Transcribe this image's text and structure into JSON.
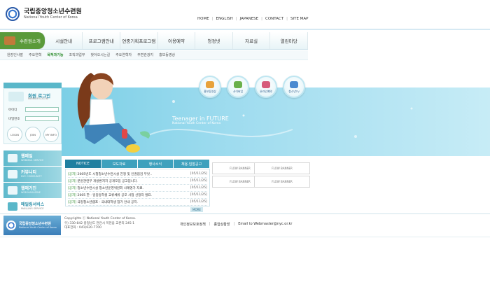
{
  "header": {
    "title": "국립중앙청소년수련원",
    "subtitle": "National Youth Center of Korea",
    "links": [
      "HOME",
      "ENGLISH",
      "JAPANESE",
      "CONTACT",
      "SITE MAP"
    ]
  },
  "nav": {
    "items": [
      "수련원소개",
      "시설안내",
      "프로그램안내",
      "연중기획프로그램",
      "이용예약",
      "청정넷",
      "자료실",
      "열린마당"
    ],
    "sub": [
      "원장인사말",
      "주요연혁",
      "목적과기능",
      "조직과업무",
      "찾아오시는길",
      "주요연혁자",
      "주변관광지",
      "홍보동영상"
    ]
  },
  "banner": {
    "tagline": "Teenager in FUTURE",
    "tagline_sub": "National Youth Center of Korea",
    "circles": [
      "홍보동영상",
      "사이버업",
      "온라인예약",
      "청소년TV"
    ]
  },
  "login": {
    "title": "회원 로그인",
    "subtitle": "MEMBER LOG IN",
    "id_label": "아이디",
    "pw_label": "비밀번호",
    "buttons": [
      "LOGIN",
      "JOIN",
      "MY INFO"
    ]
  },
  "services": [
    {
      "title": "웹메일",
      "sub": "WEBMAIL SERVICE"
    },
    {
      "title": "커뮤니티",
      "sub": "NYC COMMUNITY"
    },
    {
      "title": "웹매거진",
      "sub": "WEB MAGAZINE"
    },
    {
      "title": "메일링서비스",
      "sub": "MAILLING SERVICE"
    }
  ],
  "tabs": [
    "NOTICE",
    "보도자료",
    "행사소식",
    "채용.입찰공고"
  ],
  "notices": [
    {
      "cat": "[공지]",
      "title": "2005년도 시청청소년수련시설 진정 및 인권점검 무엇..",
      "date": "[05/11/25]"
    },
    {
      "cat": "[공지]",
      "title": "분원관련부 개방환지지 공개모집 공고입니다.",
      "date": "[05/11/25]"
    },
    {
      "cat": "[공지]",
      "title": "청소년수련시설 청소년운영위원회 사례명가 자료.",
      "date": "[05/11/25]"
    },
    {
      "cat": "[공지]",
      "title": "2005 한 · 일중등학생 교류체류 공모 사업 선정자 발표.",
      "date": "[05/11/25]"
    },
    {
      "cat": "[공지]",
      "title": "국정청소년캠프 - 국내대학생 참가 안내  공지.",
      "date": "[05/11/25]"
    }
  ],
  "more": "MORE",
  "flow_banners": [
    "FLOW BANNER",
    "FLOW BANNER",
    "FLOW BANNER",
    "FLOW BANNER"
  ],
  "footer": {
    "logo_title": "국립중앙청소년수련원",
    "logo_sub": "National Youth Center of Korea",
    "info": [
      "Copyrights ⓒ National Youth Center of Korea.",
      "우) 330-842 충청남도 천안시 목천읍 교촌리 245-1",
      "대표전화 : 041)620-7700"
    ],
    "links": [
      "개인정보보호정책",
      "종합상황방",
      "Email to Webmaster@nyc.or.kr"
    ]
  }
}
